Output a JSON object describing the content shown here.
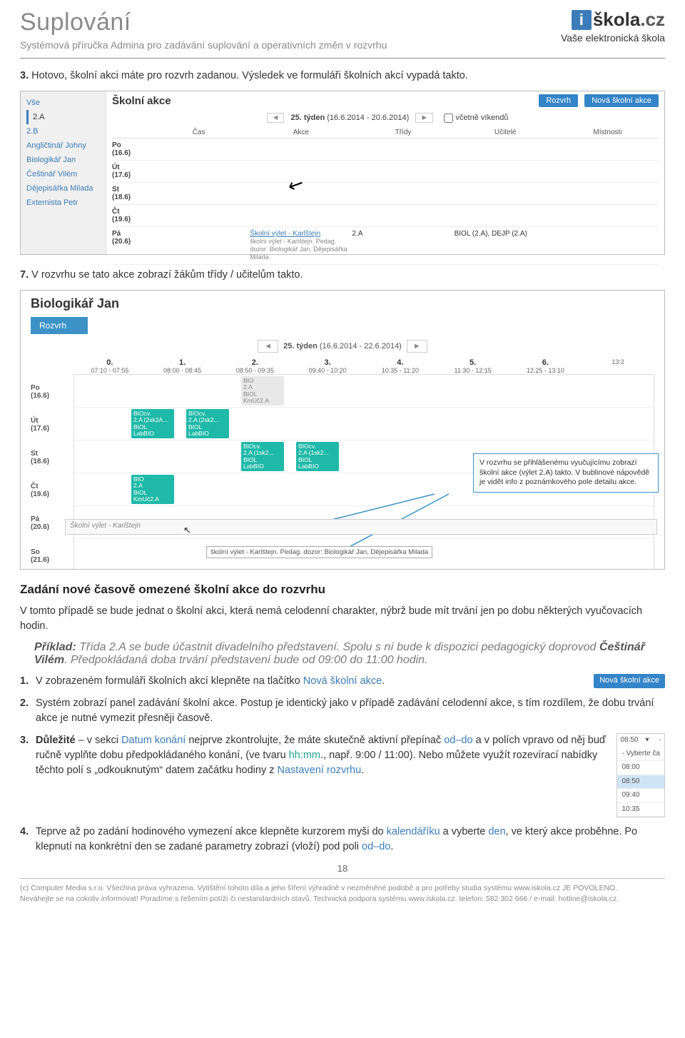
{
  "header": {
    "title": "Suplování",
    "subtitle": "Systémová příručka Admina pro zadávání suplování a operativních změn v rozvrhu",
    "logo_i": "i",
    "logo_main": "škola",
    "logo_cz": ".cz",
    "logo_sub": "Vaše elektronická škola"
  },
  "step3": {
    "num": "3.",
    "text": "Hotovo, školní akci máte pro rozvrh zadanou. Výsledek ve formuláři školních akcí vypadá takto."
  },
  "ss1": {
    "side": {
      "vse": "Vše",
      "c2a": "2.A",
      "c2b": "2.B",
      "t1": "Angličtinář Johny",
      "t2": "Biologikář Jan",
      "t3": "Češtinář Vilém",
      "t4": "Dějepisářka Milada",
      "t5": "Externista Petr"
    },
    "title": "Školní akce",
    "btn_rozvrh": "Rozvrh",
    "btn_new": "Nová školní akce",
    "week": "25. týden",
    "week_range": "(16.6.2014 - 20.6.2014)",
    "chk_weekend": "včetně víkendů",
    "cols": {
      "cas": "Čas",
      "akce": "Akce",
      "tridy": "Třídy",
      "ucitele": "Učitelé",
      "mistnosti": "Místnosti"
    },
    "days": {
      "po": "Po\n(16.6)",
      "ut": "Út\n(17.6)",
      "st": "St\n(18.6)",
      "ct": "Čt\n(19.6)",
      "pa": "Pá\n(20.6)"
    },
    "row_pa": {
      "link": "Školní výlet - Karlštejn",
      "sub": "školní výlet - Karlštejn. Pedag. dozor: Biologikář Jan, Dějepisářka Milada",
      "trida": "2.A",
      "ucitele": "BIOL (2.A), DEJP (2.A)"
    }
  },
  "step7": {
    "num": "7.",
    "text": "V rozvrhu se tato akce zobrazí žákům třídy / učitelům takto."
  },
  "ss2": {
    "title": "Biologikář Jan",
    "tab": "Rozvrh",
    "week": "25. týden",
    "week_range": "(16.6.2014 - 22.6.2014)",
    "hours": [
      {
        "n": "0.",
        "r": "07:10 - 07:55"
      },
      {
        "n": "1.",
        "r": "08:00 - 08:45"
      },
      {
        "n": "2.",
        "r": "08:50 - 09:35"
      },
      {
        "n": "3.",
        "r": "09:40 - 10:20"
      },
      {
        "n": "4.",
        "r": "10:35 - 11:20"
      },
      {
        "n": "5.",
        "r": "11:30 - 12:15"
      },
      {
        "n": "6.",
        "r": "12:25 - 13:10"
      },
      {
        "n": "",
        "r": "13:2"
      }
    ],
    "days": {
      "po": "Po\n(16.6)",
      "ut": "Út\n(17.6)",
      "st": "St\n(18.6)",
      "ct": "Čt\n(19.6)",
      "pa": "Pá\n(20.6)",
      "so": "So\n(21.6)"
    },
    "cells": {
      "po3": {
        "a": "BIO",
        "b": "2.A",
        "c": "BIOL",
        "d": "KmUč2.A"
      },
      "ut1": {
        "a": "BIOcv.",
        "b": "2.A (2sk2A...",
        "c": "BIOL",
        "d": "LabBIO"
      },
      "ut2": {
        "a": "BIOcv.",
        "b": "2.A (2sk2...",
        "c": "BIOL",
        "d": "LabBIO"
      },
      "st3": {
        "a": "BIOcv.",
        "b": "2.A (1sk2...",
        "c": "BIOL",
        "d": "LabBIO"
      },
      "st4": {
        "a": "BIOcv.",
        "b": "2.A (1sk2...",
        "c": "BIOL",
        "d": "LabBIO"
      },
      "ct1": {
        "a": "BIO",
        "b": "2.A",
        "c": "BIOL",
        "d": "KmUč2.A"
      }
    },
    "callout": "V rozvrhu se přihlášenému vyučujícímu zobrazí školní akce (výlet 2.A) takto. V bublinové nápovědě je vidět info z poznámkového pole detailu akce.",
    "event_row": "Školní výlet - Karlštejn",
    "tooltip": "školní výlet - Karlštejn. Pedag. dozor: Biologikář Jan, Dějepisářka Milada"
  },
  "sec2_title": "Zadání nové časově omezené školní akce do rozvrhu",
  "para1": "V tomto případě se bude jednat o školní akci, která nemá celodenní charakter, nýbrž bude mít trvání jen po dobu některých vyučovacích hodin.",
  "example": {
    "pref": "Příklad:",
    "t1": " Třída 2.A se bude účastnit divadelního představení. Spolu s ní bude k dispozici pedagogický doprovod ",
    "b2": "Češtinář Vilém",
    "t2": ". Předpokládaná doba trvání představení bude od 09:00 do 11:00 hodin."
  },
  "steps2": {
    "s1": {
      "n": "1.",
      "t1": "V zobrazeném formuláři školních akcí klepněte na tlačítko ",
      "link": "Nová školní akce",
      "t2": ".",
      "btn": "Nová školní akce"
    },
    "s2": {
      "n": "2.",
      "t": "Systém zobrazí panel zadávání školní akce. Postup je identický jako v případě zadávání celodenní akce, s tím rozdílem, že dobu trvání akce je nutné vymezit přesněji časově."
    },
    "s3": {
      "n": "3.",
      "bold": "Důležité",
      "t1": " – v sekci ",
      "l1": "Datum konání",
      "t2": " nejprve zkontrolujte, že máte skutečně aktivní přepínač ",
      "l2": "od–do",
      "t3": " a v polích vpravo od něj buď ručně vyplňte dobu předpokládaného konání, (ve tvaru ",
      "teal": "hh:mm",
      "t4": "., např. 9:00 / 11:00). Nebo můžete využít rozevírací nabídky těchto polí s „odkouknutým“ datem začátku hodiny z ",
      "l3": "Nastavení rozvrhu",
      "t5": ".",
      "dropdown": {
        "top": "08:50",
        "opt0": "- Vyberte ča",
        "o1": "08:00",
        "o2": "08:50",
        "o3": "09:40",
        "o4": "10:35"
      }
    },
    "s4": {
      "n": "4.",
      "t1": "Teprve až po zadání hodinového vymezení akce klepněte kurzorem myši do ",
      "l1": "kalendáříku",
      "t2": " a vyberte ",
      "l2": "den",
      "t3": ", ve který akce proběhne. Po klepnutí na konkrétní den se zadané parametry zobrazí (vloží) pod poli ",
      "l3": "od–do",
      "t4": "."
    }
  },
  "page_num": "18",
  "footer": {
    "l1a": "(c) Computer Media s.r.o. Všechna práva vyhrazena. Vytištění tohoto díla a jeho šíření výhradně v nezměněné podobě a pro potřeby studia systému www.iskola.cz JE POVOLENO.",
    "l2a": "Neváhejte se na cokoliv informovat! Poradíme s řešením potíží či nestandardních stavů. Technická podpora systému www.iskola.cz: telefon: 582 302 666 / e-mail: hotline@iskola.cz."
  }
}
